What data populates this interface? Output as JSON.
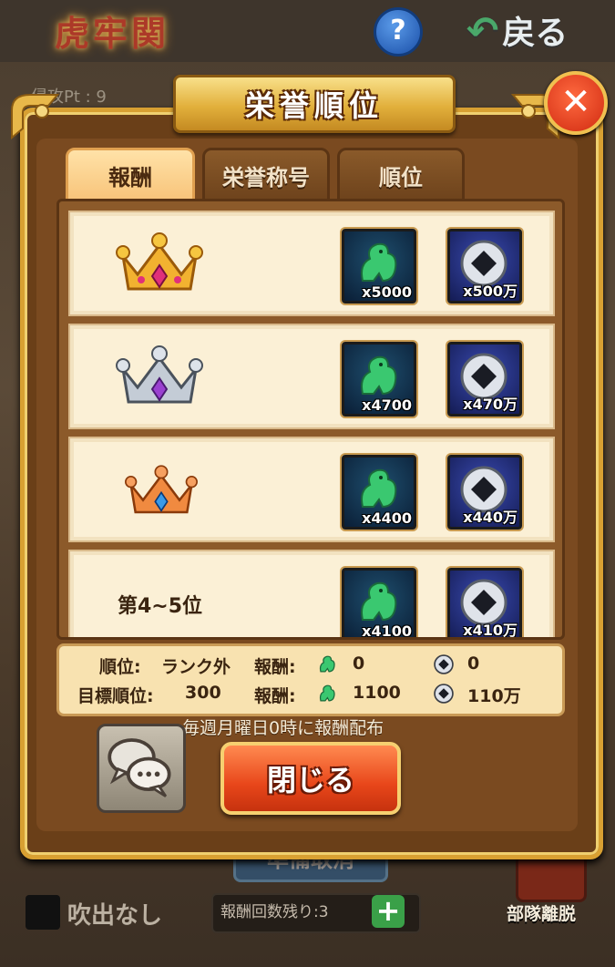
{
  "background": {
    "title": "虎牢関",
    "help_label": "?",
    "back_label": "戻る",
    "sub_text": "侵攻Pt : 9",
    "prep_label": "準備取消",
    "fukidashi_label": "吹出なし",
    "remaining_label": "報酬回数残り:3",
    "plus_label": "+",
    "leave_label": "部隊離脱"
  },
  "dialog": {
    "title": "栄誉順位",
    "close_x": "✕",
    "tabs": [
      {
        "label": "報酬",
        "active": true
      },
      {
        "label": "栄誉称号",
        "active": false
      },
      {
        "label": "順位",
        "active": false
      }
    ],
    "rewards": [
      {
        "rank": "1",
        "rank_icon": "gold-crown-icon",
        "rank_text": "",
        "jade_qty": "x5000",
        "coin_qty": "x500万"
      },
      {
        "rank": "2",
        "rank_icon": "silver-crown-icon",
        "rank_text": "",
        "jade_qty": "x4700",
        "coin_qty": "x470万"
      },
      {
        "rank": "3",
        "rank_icon": "bronze-crown-icon",
        "rank_text": "",
        "jade_qty": "x4400",
        "coin_qty": "x440万"
      },
      {
        "rank": "4-5",
        "rank_icon": "",
        "rank_text": "第4~5位",
        "jade_qty": "x4100",
        "coin_qty": "x410万"
      }
    ],
    "status": {
      "rank_label": "順位:",
      "rank_value": "ランク外",
      "reward_label_1": "報酬:",
      "reward_jade_1": "0",
      "reward_coin_1": "0",
      "target_label": "目標順位:",
      "target_value": "300",
      "reward_label_2": "報酬:",
      "reward_jade_2": "1100",
      "reward_coin_2": "110万"
    },
    "weekly_note": "毎週月曜日0時に報酬配布",
    "close_button": "閉じる"
  },
  "colors": {
    "panel_brown": "#6a3f18",
    "gold_trim": "#d8a032",
    "row_cream": "#fbf0d6",
    "close_button_orange": "#e8461a",
    "jade_green": "#3ac870"
  }
}
